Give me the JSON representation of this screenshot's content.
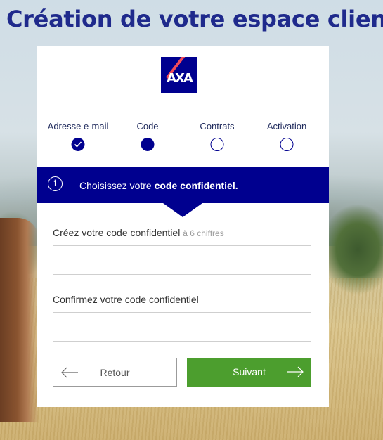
{
  "page": {
    "title": "Création de votre espace client"
  },
  "brand": {
    "logo_text": "AXA",
    "color": "#00008f",
    "accent": "#f24b5b"
  },
  "steps": [
    {
      "label": "Adresse e-mail",
      "state": "done"
    },
    {
      "label": "Code",
      "state": "current"
    },
    {
      "label": "Contrats",
      "state": "todo"
    },
    {
      "label": "Activation",
      "state": "todo"
    }
  ],
  "info": {
    "icon": "info-icon",
    "text_prefix": "Choisissez votre ",
    "text_bold": "code confidentiel."
  },
  "form": {
    "code_label": "Créez votre code confidentiel",
    "code_hint": "à 6 chiffres",
    "code_value": "",
    "confirm_label": "Confirmez votre code confidentiel",
    "confirm_value": ""
  },
  "buttons": {
    "back_label": "Retour",
    "next_label": "Suivant",
    "next_color": "#4c9e2e"
  }
}
